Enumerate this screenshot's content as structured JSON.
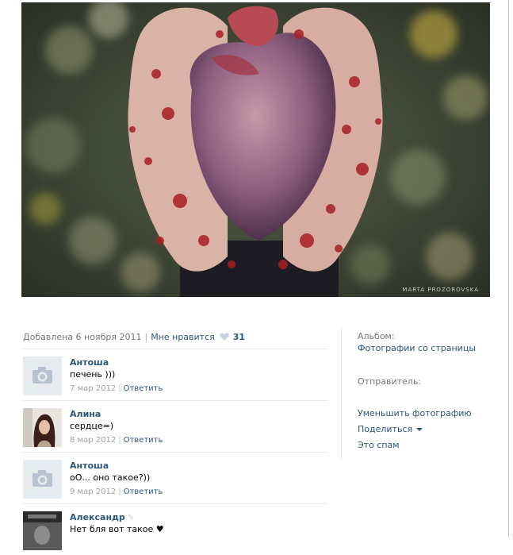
{
  "photo": {
    "watermark": "MARTA PROZOROVSKA"
  },
  "meta": {
    "added": "Добавлена 6 ноября 2011",
    "like_label": "Мне нравится",
    "like_count": "31"
  },
  "comments": [
    {
      "author": "Антоша",
      "text": "печень )))",
      "date": "7 мар 2012",
      "reply": "Ответить",
      "avatar": "camera-placeholder"
    },
    {
      "author": "Алина",
      "text": "сердце=)",
      "date": "8 мар 2012",
      "reply": "Ответить",
      "avatar": "photo"
    },
    {
      "author": "Антоша",
      "text": "оО... оно такое?))",
      "date": "9 мар 2012",
      "reply": "Ответить",
      "avatar": "camera-placeholder"
    },
    {
      "author": "Александр",
      "text": "Нет бля вот такое ♥",
      "date": "",
      "reply": "",
      "avatar": "photo"
    }
  ],
  "sidebar": {
    "album_label": "Альбом:",
    "album_link": "Фотографии со страницы",
    "sender_label": "Отправитель:",
    "shrink_link": "Уменьшить фотографию",
    "share_link": "Поделиться",
    "spam_link": "Это спам"
  },
  "colors": {
    "link": "#2b587a",
    "muted": "#777777",
    "divider": "#e5e9ee"
  }
}
